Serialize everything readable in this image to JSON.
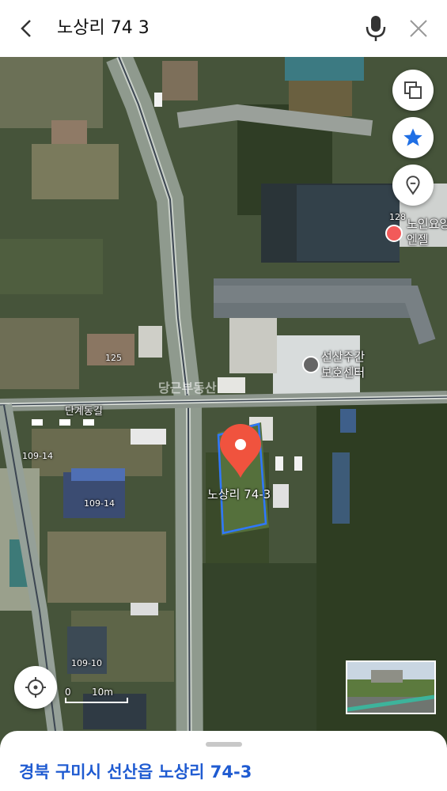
{
  "search": {
    "query": "노상리 74 3"
  },
  "map": {
    "place_labels": [
      {
        "id": "n128",
        "text": "128"
      },
      {
        "id": "nursing1",
        "text": "노인요양"
      },
      {
        "id": "nursing2",
        "text": "엔젤"
      },
      {
        "id": "n125",
        "text": "125"
      },
      {
        "id": "center1",
        "text": "선산주간"
      },
      {
        "id": "center2",
        "text": "보호센터"
      },
      {
        "id": "road",
        "text": "단계동길"
      },
      {
        "id": "n109_14a",
        "text": "109-14"
      },
      {
        "id": "n109_14b",
        "text": "109-14"
      },
      {
        "id": "n109_10",
        "text": "109-10"
      },
      {
        "id": "pin",
        "text": "노상리 74-3"
      }
    ],
    "watermark": "당근부동산",
    "scale": {
      "zero": "0",
      "distance": "10m"
    },
    "marker_color": "#f0533e",
    "parcel_outline_color": "#2f78ff"
  },
  "controls": {
    "layers_icon": "layers-icon",
    "favorite_icon": "star-icon",
    "pin_icon": "location-pin-icon",
    "locate_icon": "crosshair-icon"
  },
  "sheet": {
    "address": "경북 구미시 선산읍 노상리 74-3"
  },
  "colors": {
    "accent": "#1f5bd1",
    "favorite": "#1f6fe5"
  }
}
